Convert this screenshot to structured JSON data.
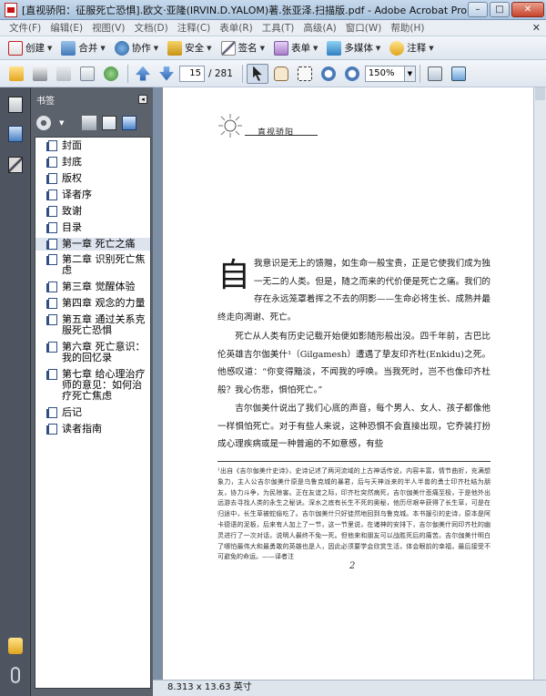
{
  "window": {
    "title": "[直视骄阳：征服死亡恐惧].欧文·亚隆(IRVIN.D.YALOM)著.张亚泽.扫描版.pdf - Adobe Acrobat Pro",
    "min": "–",
    "max": "□",
    "close": "✕"
  },
  "menu": {
    "items": [
      "文件(F)",
      "编辑(E)",
      "视图(V)",
      "文档(D)",
      "注释(C)",
      "表单(R)",
      "工具(T)",
      "高级(A)",
      "窗口(W)",
      "帮助(H)"
    ],
    "close": "✕"
  },
  "toolbar1": {
    "create": "创建",
    "combine": "合并",
    "collaborate": "协作",
    "secure": "安全",
    "sign": "签名",
    "forms": "表单",
    "multimedia": "多媒体",
    "comment": "注释"
  },
  "toolbar2": {
    "page_current": "15",
    "page_total": "/ 281",
    "zoom": "150%"
  },
  "bookmarks": {
    "title": "书签",
    "collapse": "◂",
    "items": [
      "封面",
      "封底",
      "版权",
      "译者序",
      "致谢",
      "目录",
      "第一章 死亡之痛",
      "第二章 识别死亡焦虑",
      "第三章 觉醒体验",
      "第四章 观念的力量",
      "第五章 通过关系克服死亡恐惧",
      "第六章 死亡意识：我的回忆录",
      "第七章 给心理治疗师的意见：如何治疗死亡焦虑",
      "后记",
      "读者指南"
    ]
  },
  "page": {
    "running_head": "直视骄阳",
    "dropcap": "自",
    "para1": "我意识是无上的馈赠，如生命一般宝贵，正是它使我们成为独一无二的人类。但是，随之而来的代价便是死亡之痛。我们的存在永远笼罩着挥之不去的阴影——生命必将生长、成熟并最终走向凋谢、死亡。",
    "para2": "死亡从人类有历史记载开始便如影随形般出没。四千年前，古巴比伦英雄吉尔伽美什¹（Gilgamesh）遭遇了挚友印齐杜(Enkidu)之死。他感叹道：“你变得黯淡，不闻我的呼唤。当我死时，岂不也像印齐杜般？我心伤悲，惧怕死亡。”",
    "para3": "吉尔伽美什说出了我们心底的声音，每个男人、女人、孩子都像他一样惧怕死亡。对于有些人来说，这种恐惧不会直接出现，它乔装打扮成心理疾病或是一种普遍的不如意感，有些",
    "footnote": "¹出自《吉尔伽美什史诗》，史诗记述了两河流域的上古神话传说，内容丰富，情节曲折，充满想象力，主人公吉尔伽美什原是乌鲁克城的暴君，后与天神派来的半人半兽的勇士印齐杜结为朋友，协力斗争，为民除害。正在友谊之际，印齐杜突然病死，吉尔伽美什悲痛至极，于是他外出远游去寻找人类的永生之秘诀。深水之底有长生不死的奥秘，他历尽艰辛获得了长生草，可是在归途中，长生草被蛇偷吃了。吉尔伽美什只好徒然地回到乌鲁克城。本书援引的史诗，原本是阿卡德语的泥板，后来有人加上了一节，这一节里说，在诸神的安排下，吉尔伽美什同印齐杜的幽灵进行了一次对话，说明人最终不免一死。但他来和朋友可以战胜死后的痛苦。吉尔伽美什明白了哪怕最伟大和最勇敢的英雄也是人，因此必须要学会欣赏生活，体会眼前的幸福，最后接受不可避免的命运。——译者注",
    "page_number": "2"
  },
  "status": {
    "page_size": "8.313 x 13.63 英寸"
  }
}
